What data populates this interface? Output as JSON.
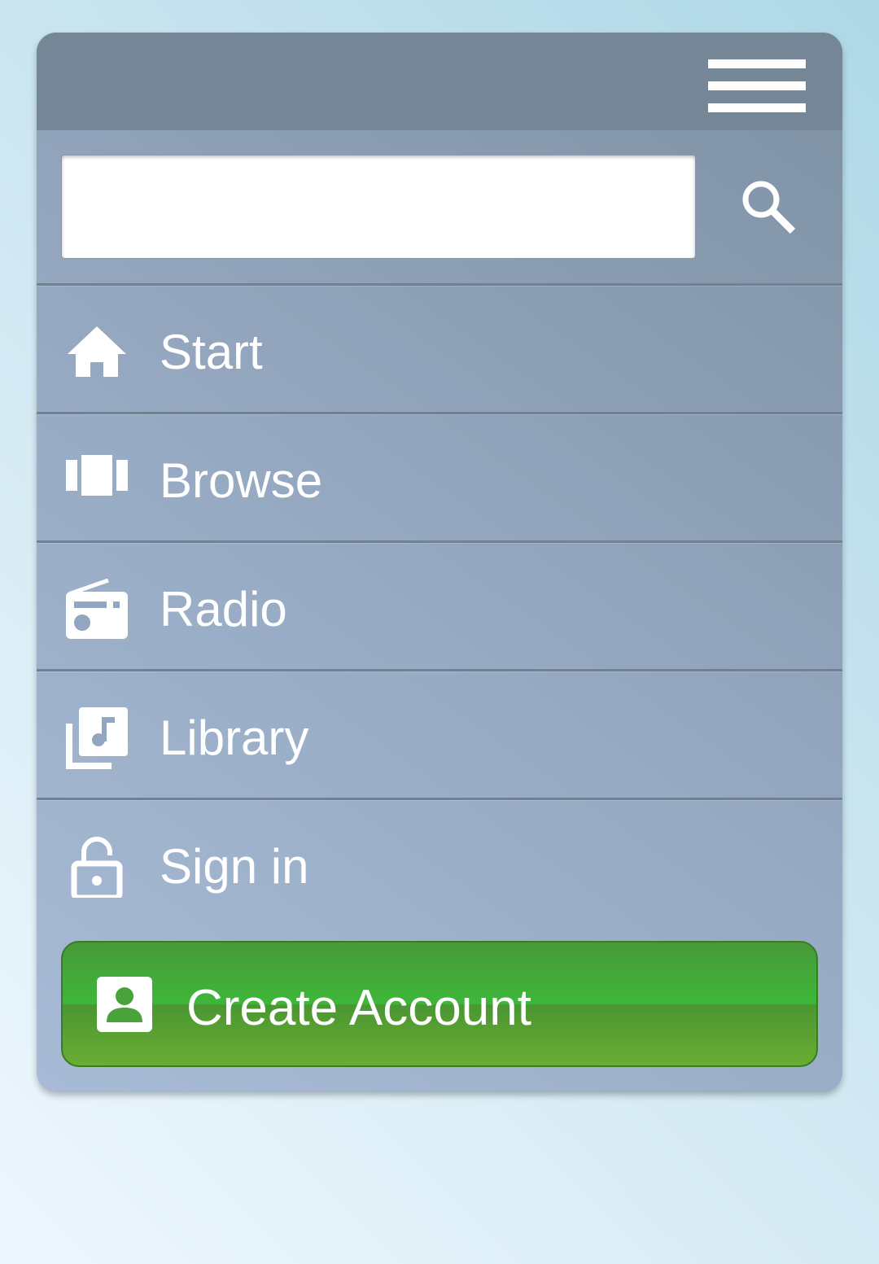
{
  "header": {
    "menu_icon": "hamburger-menu-icon"
  },
  "search": {
    "value": "",
    "placeholder": "",
    "button_icon": "search-icon"
  },
  "menu": {
    "items": [
      {
        "label": "Start",
        "icon": "home-icon"
      },
      {
        "label": "Browse",
        "icon": "browse-icon"
      },
      {
        "label": "Radio",
        "icon": "radio-icon"
      },
      {
        "label": "Library",
        "icon": "library-icon"
      },
      {
        "label": "Sign in",
        "icon": "unlock-icon"
      }
    ]
  },
  "create_account": {
    "label": "Create Account",
    "icon": "account-box-icon"
  },
  "colors": {
    "header_bar": "#758796",
    "panel_light": "#a8bbd6",
    "panel_dark": "#7e90a2",
    "button_green": "#3db739",
    "text": "#ffffff"
  }
}
